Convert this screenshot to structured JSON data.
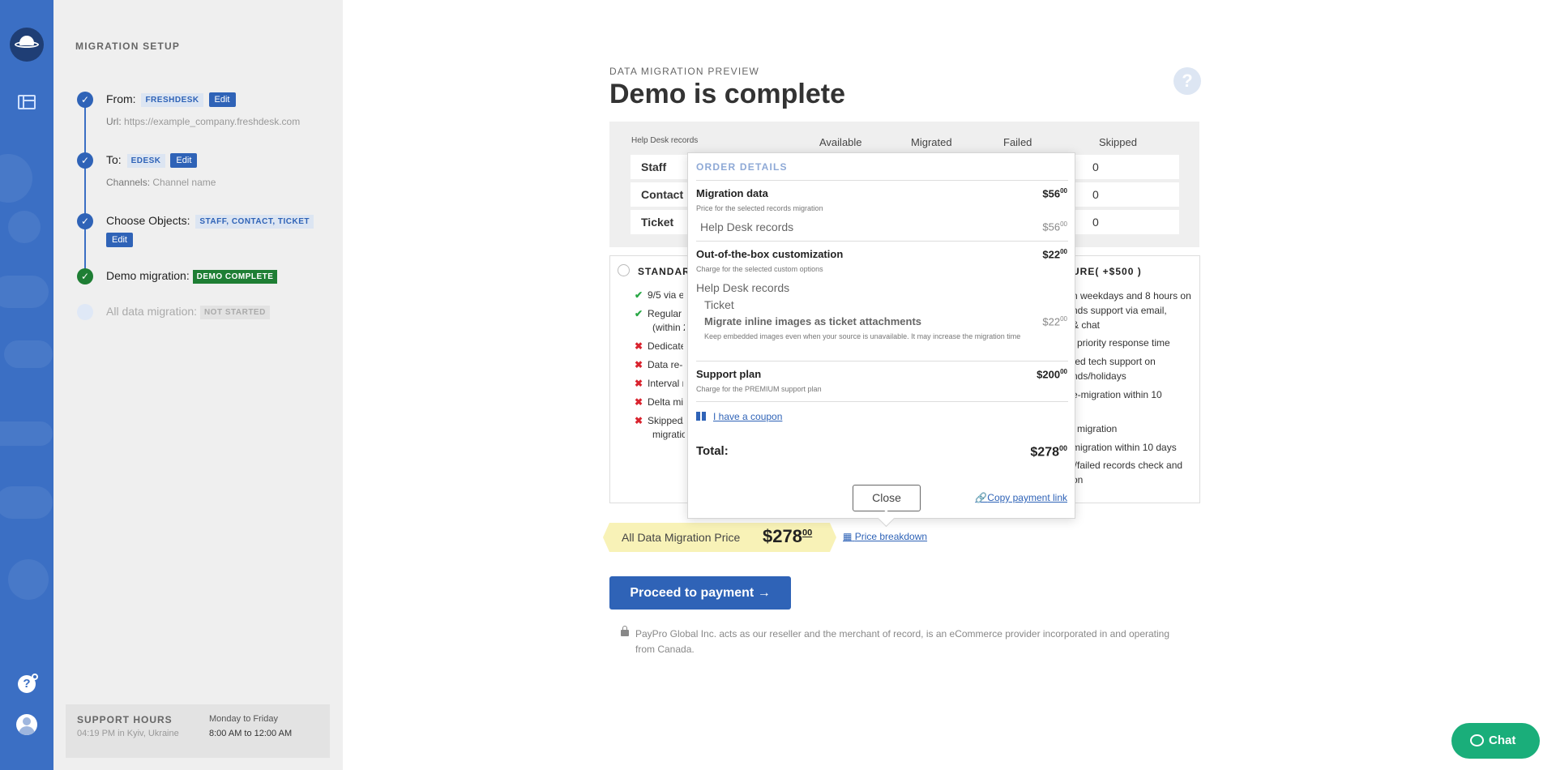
{
  "sidebar": {
    "heading": "MIGRATION SETUP",
    "steps": [
      {
        "label": "From:",
        "tag": "FRESHDESK",
        "edit": "Edit",
        "sub_label": "Url:",
        "sub_value": "https://example_company.freshdesk.com"
      },
      {
        "label": "To:",
        "tag": "EDESK",
        "edit": "Edit",
        "sub_label": "Channels:",
        "sub_value": "Channel name"
      },
      {
        "label": "Choose Objects:",
        "tag": "STAFF, CONTACT, TICKET",
        "edit": "Edit"
      },
      {
        "label": "Demo migration:",
        "tag": "DEMO COMPLETE"
      },
      {
        "label": "All data migration:",
        "tag": "NOT STARTED"
      }
    ],
    "support": {
      "title": "SUPPORT HOURS",
      "local_time": "04:19 PM in Kyiv, Ukraine",
      "days": "Monday to Friday",
      "hours": "8:00 AM to 12:00 AM"
    }
  },
  "main": {
    "eyebrow": "DATA MIGRATION PREVIEW",
    "title": "Demo is complete",
    "records": {
      "group_label": "Help Desk records",
      "columns": [
        "Available",
        "Migrated",
        "Failed",
        "Skipped"
      ],
      "rows": [
        {
          "name": "Staff",
          "skipped": "0"
        },
        {
          "name": "Contact",
          "skipped": "0"
        },
        {
          "name": "Ticket",
          "skipped": "0"
        }
      ]
    },
    "plans": {
      "left_name": "STANDAR",
      "right_name": "URE( +$500 )",
      "left_features": [
        {
          "icon": "✔",
          "type": "ok",
          "text": "9/5 via e"
        },
        {
          "icon": "✔",
          "type": "ok",
          "text": "Regular S",
          "text2": "(within 2"
        },
        {
          "icon": "✖",
          "type": "no",
          "text": "Dedicate"
        },
        {
          "icon": "✖",
          "type": "no",
          "text": "Data re-"
        },
        {
          "icon": "✖",
          "type": "no",
          "text": "Interval r"
        },
        {
          "icon": "✖",
          "type": "no",
          "text": "Delta mig"
        },
        {
          "icon": "✖",
          "type": "no",
          "text": "Skipped/",
          "text2": "migration"
        }
      ],
      "right_features": [
        "n weekdays and 8 hours on",
        "nds support via email,",
        "& chat",
        "l priority response time",
        "ted tech support on",
        "nds/holidays",
        "e-migration within 10",
        "l migration",
        " migration within 10 days",
        "l/failed records check and",
        "on"
      ]
    },
    "price": {
      "label": "All Data Migration Price",
      "amount": "$278",
      "cents": "00"
    },
    "breakdown_link": "Price breakdown",
    "proceed_button": "Proceed to payment →",
    "legal": "PayPro Global Inc. acts as our reseller and the merchant of record, is an eCommerce provider incorporated in and operating from Canada."
  },
  "popup": {
    "header": "ORDER DETAILS",
    "migration": {
      "title": "Migration data",
      "desc": "Price for the selected records migration",
      "price": "$56",
      "cents": "00",
      "item": "Help Desk records",
      "item_price": "$56",
      "item_cents": "00"
    },
    "custom": {
      "title": "Out-of-the-box customization",
      "desc": "Charge for the selected custom options",
      "price": "$22",
      "cents": "00",
      "group": "Help Desk records",
      "object": "Ticket",
      "option": "Migrate inline images as ticket attachments",
      "option_desc": "Keep embedded images even when your source is unavailable. It may increase the migration time",
      "option_price": "$22",
      "option_cents": "00"
    },
    "support": {
      "title": "Support plan",
      "desc": "Charge for the PREMIUM support plan",
      "price": "$200",
      "cents": "00"
    },
    "coupon": "I have a coupon",
    "total_label": "Total:",
    "total": "$278",
    "total_cents": "00",
    "close": "Close",
    "copy_link": "Copy payment link"
  },
  "chat": {
    "label": "Chat"
  }
}
